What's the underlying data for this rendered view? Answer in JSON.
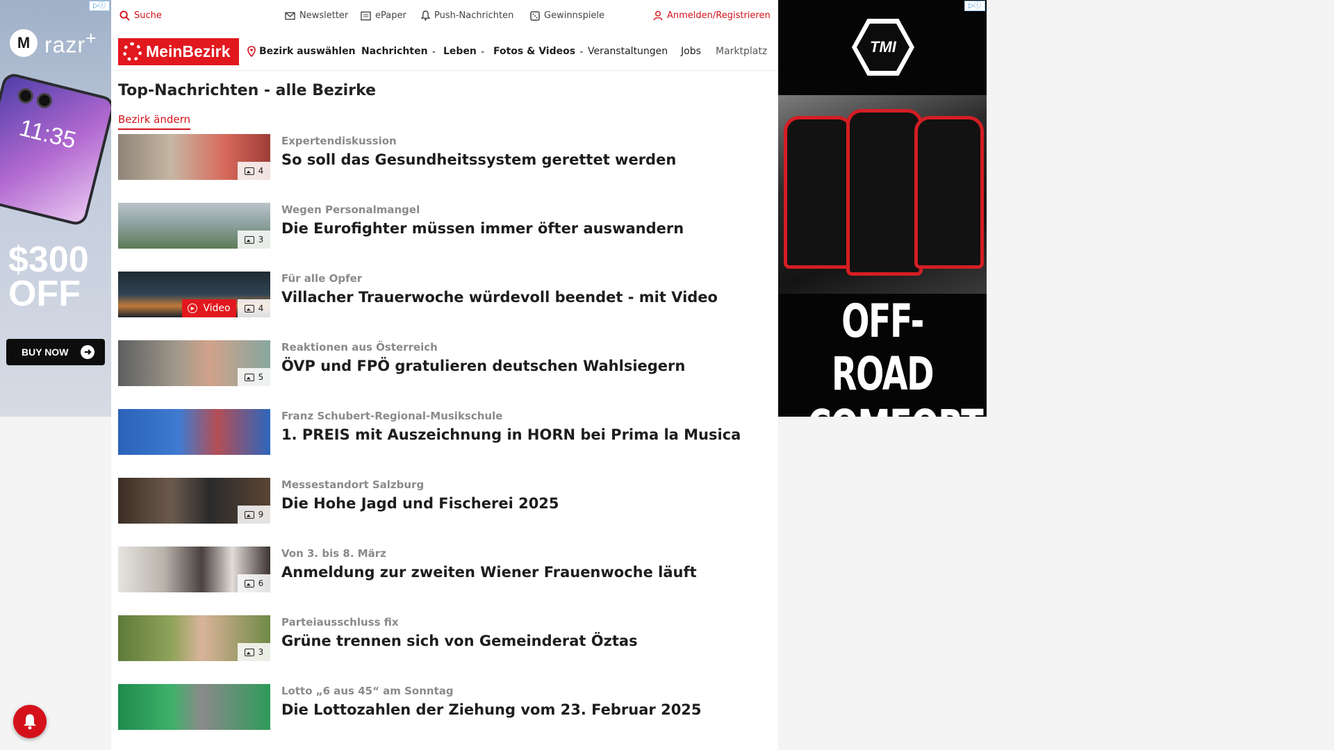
{
  "left_ad": {
    "adchoices": "▷ⓘ",
    "brand": "razr",
    "brand_suffix": "+",
    "phone_time": "11:35",
    "offer_line1": "$300",
    "offer_line2": "OFF",
    "cta": "BUY NOW"
  },
  "topbar": {
    "search": "Suche",
    "newsletter": "Newsletter",
    "epaper": "ePaper",
    "push": "Push-Nachrichten",
    "gewinnspiele": "Gewinnspiele",
    "login": "Anmelden/Registrieren"
  },
  "nav": {
    "logo": "MeinBezirk",
    "bezirk": "Bezirk auswählen",
    "items": [
      "Nachrichten",
      "Leben",
      "Fotos & Videos",
      "Veranstaltungen",
      "Jobs",
      "Marktplatz"
    ]
  },
  "page": {
    "title": "Top-Nachrichten - alle Bezirke",
    "change_link": "Bezirk ändern"
  },
  "articles": [
    {
      "kicker": "Expertendiskussion",
      "headline": "So soll das Gesundheitssystem gerettet werden",
      "count": "4",
      "video": ""
    },
    {
      "kicker": "Wegen Personalmangel",
      "headline": "Die Eurofighter müssen immer öfter auswandern",
      "count": "3",
      "video": ""
    },
    {
      "kicker": "Für alle Opfer",
      "headline": "Villacher Trauerwoche würdevoll beendet - mit Video",
      "count": "4",
      "video": "Video"
    },
    {
      "kicker": "Reaktionen aus Österreich",
      "headline": "ÖVP und FPÖ gratulieren deutschen Wahlsiegern",
      "count": "5",
      "video": ""
    },
    {
      "kicker": "Franz Schubert-Regional-Musikschule",
      "headline": "1. PREIS mit Auszeichnung in HORN bei Prima la Musica",
      "count": "",
      "video": ""
    },
    {
      "kicker": "Messestandort Salzburg",
      "headline": "Die Hohe Jagd und Fischerei 2025",
      "count": "9",
      "video": ""
    },
    {
      "kicker": "Von 3. bis 8. März",
      "headline": "Anmeldung zur zweiten Wiener Frauenwoche läuft",
      "count": "6",
      "video": ""
    },
    {
      "kicker": "Parteiausschluss fix",
      "headline": "Grüne trennen sich von Gemeinderat Öztas",
      "count": "3",
      "video": ""
    },
    {
      "kicker": "Lotto „6 aus 45“ am Sonntag",
      "headline": "Die Lottozahlen der Ziehung vom 23. Februar 2025",
      "count": "",
      "video": ""
    }
  ],
  "right_ad": {
    "adchoices": "▷ⓘ",
    "brand": "TMI",
    "line1": "OFF-ROAD",
    "line2": "COMFORT"
  },
  "colors": {
    "brand_red": "#e1181e",
    "link_red": "#d4111b",
    "kicker_gray": "#8a8a8a"
  }
}
